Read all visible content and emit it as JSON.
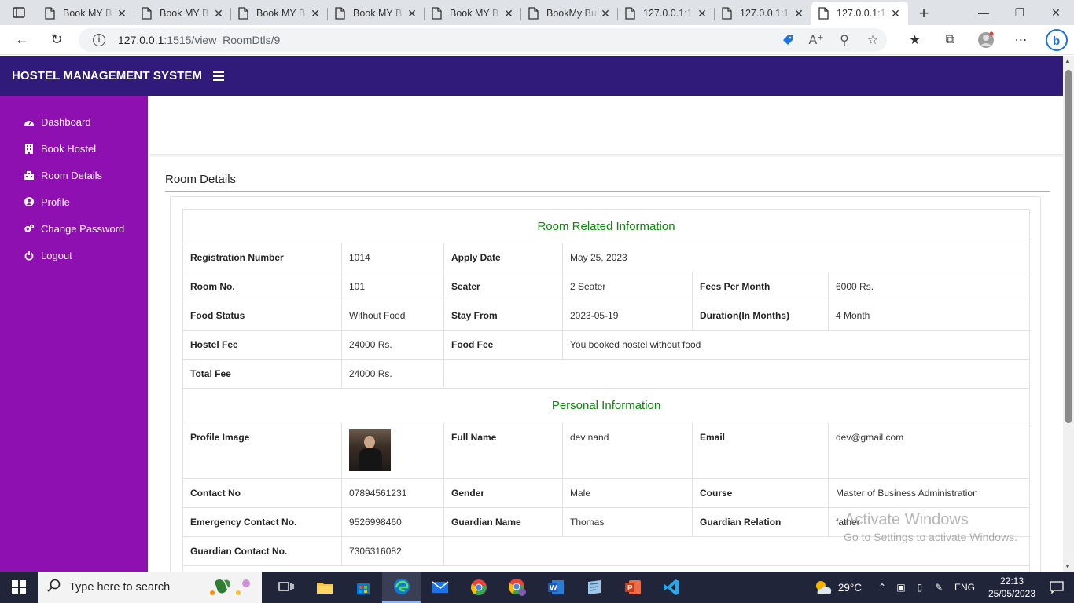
{
  "browser": {
    "tabs": [
      {
        "title": "Book MY B",
        "active": false
      },
      {
        "title": "Book MY B",
        "active": false
      },
      {
        "title": "Book MY B",
        "active": false
      },
      {
        "title": "Book MY B",
        "active": false
      },
      {
        "title": "Book MY B",
        "active": false
      },
      {
        "title": "BookMy Bu",
        "active": false
      },
      {
        "title": "127.0.0.1:1",
        "active": false
      },
      {
        "title": "127.0.0.1:1",
        "active": false
      },
      {
        "title": "127.0.0.1:1",
        "active": true
      }
    ],
    "url_host": "127.0.0.1",
    "url_path": ":1515/view_RoomDtls/9"
  },
  "app": {
    "brand": "HOSTEL MANAGEMENT SYSTEM",
    "sidebar": [
      {
        "label": "Dashboard",
        "icon": "dashboard-icon"
      },
      {
        "label": "Book Hostel",
        "icon": "building-icon"
      },
      {
        "label": "Room Details",
        "icon": "room-icon"
      },
      {
        "label": "Profile",
        "icon": "user-icon"
      },
      {
        "label": "Change Password",
        "icon": "gears-icon"
      },
      {
        "label": "Logout",
        "icon": "power-icon"
      }
    ],
    "panel_title": "Room Details"
  },
  "room_info": {
    "section_title": "Room Related Information",
    "registration_number_label": "Registration Number",
    "registration_number": "1014",
    "apply_date_label": "Apply Date",
    "apply_date": "May 25, 2023",
    "room_no_label": "Room No.",
    "room_no": "101",
    "seater_label": "Seater",
    "seater": "2 Seater",
    "fees_label": "Fees Per Month",
    "fees": "6000 Rs.",
    "food_status_label": "Food Status",
    "food_status": "Without Food",
    "stay_from_label": "Stay From",
    "stay_from": "2023-05-19",
    "duration_label": "Duration(In Months)",
    "duration": "4 Month",
    "hostel_fee_label": "Hostel Fee",
    "hostel_fee": "24000 Rs.",
    "food_fee_label": "Food Fee",
    "food_fee": "You booked hostel without food",
    "total_fee_label": "Total Fee",
    "total_fee": "24000 Rs."
  },
  "personal_info": {
    "section_title": "Personal Information",
    "profile_image_label": "Profile Image",
    "full_name_label": "Full Name",
    "full_name": "dev nand",
    "email_label": "Email",
    "email": "dev@gmail.com",
    "contact_label": "Contact No",
    "contact": "07894561231",
    "gender_label": "Gender",
    "gender": "Male",
    "course_label": "Course",
    "course": "Master of Business Administration",
    "emergency_label": "Emergency Contact No.",
    "emergency": "9526998460",
    "guardian_name_label": "Guardian Name",
    "guardian_name": "Thomas",
    "guardian_relation_label": "Guardian Relation",
    "guardian_relation": "father",
    "guardian_contact_label": "Guardian Contact No.",
    "guardian_contact": "7306316082"
  },
  "watermark": {
    "line1": "Activate Windows",
    "line2": "Go to Settings to activate Windows."
  },
  "taskbar": {
    "search_placeholder": "Type here to search",
    "temperature": "29°C",
    "language": "ENG",
    "time": "22:13",
    "date": "25/05/2023"
  }
}
